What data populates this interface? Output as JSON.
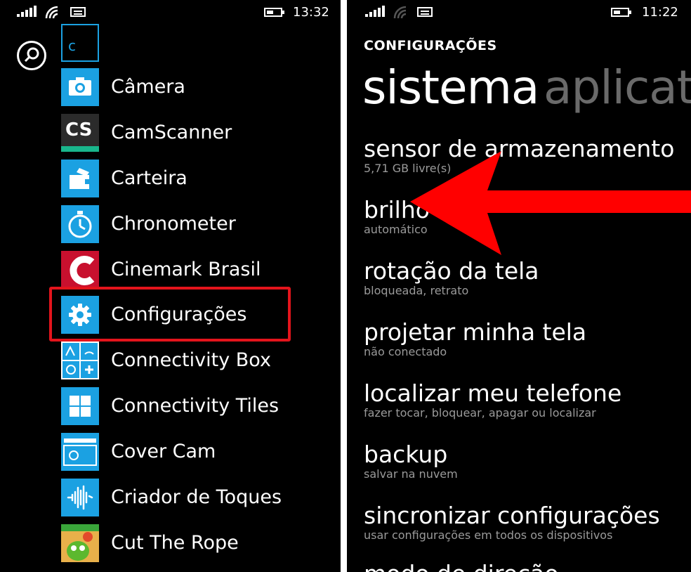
{
  "left_phone": {
    "status_bar": {
      "time": "13:32"
    },
    "letter_group": "c",
    "apps": [
      {
        "label": "Câmera",
        "icon": "camera-icon"
      },
      {
        "label": "CamScanner",
        "icon": "camscanner-logo",
        "logo_text": "CS"
      },
      {
        "label": "Carteira",
        "icon": "wallet-icon"
      },
      {
        "label": "Chronometer",
        "icon": "stopwatch-icon"
      },
      {
        "label": "Cinemark Brasil",
        "icon": "cinemark-logo"
      },
      {
        "label": "Configurações",
        "icon": "gear-icon"
      },
      {
        "label": "Connectivity Box",
        "icon": "connectivity-box-icon"
      },
      {
        "label": "Connectivity Tiles",
        "icon": "windows-tiles-icon"
      },
      {
        "label": "Cover Cam",
        "icon": "cover-cam-icon"
      },
      {
        "label": "Criador de Toques",
        "icon": "sound-wave-icon"
      },
      {
        "label": "Cut The Rope",
        "icon": "cut-the-rope-icon"
      }
    ],
    "highlight_color": "#e3141c"
  },
  "right_phone": {
    "status_bar": {
      "time": "11:22"
    },
    "header": "CONFIGURAÇÕES",
    "pivot": {
      "active": "sistema",
      "next": "aplicati"
    },
    "settings": [
      {
        "title": "sensor de armazenamento",
        "subtitle": "5,71 GB livre(s)"
      },
      {
        "title": "brilho",
        "subtitle": "automático"
      },
      {
        "title": "rotação da tela",
        "subtitle": "bloqueada, retrato"
      },
      {
        "title": "projetar minha tela",
        "subtitle": "não conectado"
      },
      {
        "title": "localizar meu telefone",
        "subtitle": "fazer tocar, bloquear, apagar ou localizar"
      },
      {
        "title": "backup",
        "subtitle": "salvar na nuvem"
      },
      {
        "title": "sincronizar configurações",
        "subtitle": "usar configurações em todos os dispositivos"
      },
      {
        "title": "modo de direção",
        "subtitle": ""
      }
    ],
    "arrow_color": "#ff0000"
  },
  "colors": {
    "accent": "#1ba1e2",
    "background": "#000000",
    "subtitle": "#9a9a9a",
    "pivot_inactive": "#6a6a6a"
  }
}
